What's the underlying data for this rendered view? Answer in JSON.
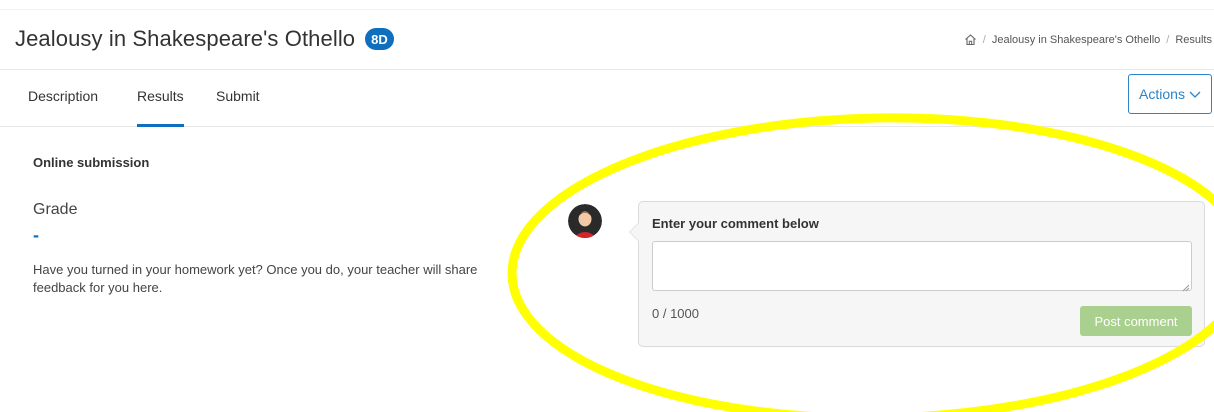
{
  "header": {
    "title": "Jealousy in Shakespeare's Othello",
    "badge": "8D",
    "breadcrumb": {
      "home_icon": "home-icon",
      "separator": "/",
      "items": [
        "Jealousy in Shakespeare's Othello",
        "Results"
      ]
    }
  },
  "tabs": {
    "items": [
      {
        "label": "Description"
      },
      {
        "label": "Results"
      },
      {
        "label": "Submit"
      }
    ],
    "active": "Results",
    "actions_label": "Actions",
    "actions_icon": "chevron-down-icon"
  },
  "main": {
    "section_title": "Online submission",
    "grade_label": "Grade",
    "grade_value": "-",
    "info_text": "Have you turned in your homework yet? Once you do, your teacher will share feedback for you here."
  },
  "comment": {
    "heading": "Enter your comment below",
    "input_value": "",
    "placeholder": "",
    "counter": "0 / 1000",
    "post_label": "Post comment"
  },
  "colors": {
    "accent": "#0d6fbd",
    "post_button": "#a9d08e",
    "annotation": "#ffff00"
  }
}
